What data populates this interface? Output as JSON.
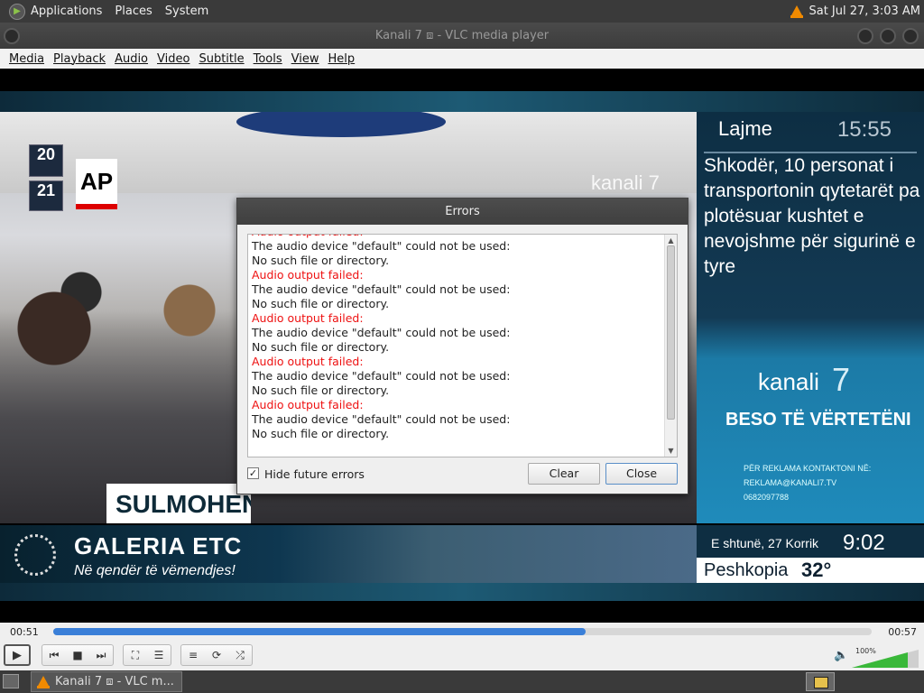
{
  "top_panel": {
    "menus": [
      "Applications",
      "Places",
      "System"
    ],
    "clock": "Sat Jul 27,  3:03 AM"
  },
  "window": {
    "title": "Kanali 7 ⧈ - VLC media player"
  },
  "menubar": [
    "Media",
    "Playback",
    "Audio",
    "Video",
    "Subtitle",
    "Tools",
    "View",
    "Help"
  ],
  "video": {
    "ap_logo": "AP",
    "gate_top": "20",
    "gate_bottom": "21",
    "watermark": "kanali 7",
    "lower_caption": "SULMOHEN",
    "side_panel": {
      "section": "Lajme",
      "time": "15:55",
      "headline": "Shkodër, 10 personat i transportonin qytetarët pa plotësuar kushtet e nevojshme për sigurinë e tyre",
      "brand": "kanali",
      "brand_num": "7",
      "slogan": "BESO TË VËRTETËNI",
      "ad_line1": "PËR REKLAMA KONTAKTONI NË:",
      "ad_email": "REKLAMA@KANALI7.TV",
      "ad_phone": "0682097788"
    },
    "ticker": {
      "title": "GALERIA ETC",
      "subtitle": "Në qendër të vëmendjes!",
      "date": "E shtunë, 27 Korrik",
      "clock": "9:02",
      "city": "Peshkopia",
      "temp": "32°"
    }
  },
  "errors_dialog": {
    "title": "Errors",
    "log": [
      {
        "type": "err",
        "text": "Audio output failed:"
      },
      {
        "type": "msg",
        "text": "The audio device \"default\" could not be used:"
      },
      {
        "type": "msg",
        "text": "No such file or directory."
      },
      {
        "type": "err",
        "text": "Audio output failed:"
      },
      {
        "type": "msg",
        "text": "The audio device \"default\" could not be used:"
      },
      {
        "type": "msg",
        "text": "No such file or directory."
      },
      {
        "type": "err",
        "text": "Audio output failed:"
      },
      {
        "type": "msg",
        "text": "The audio device \"default\" could not be used:"
      },
      {
        "type": "msg",
        "text": "No such file or directory."
      },
      {
        "type": "err",
        "text": "Audio output failed:"
      },
      {
        "type": "msg",
        "text": "The audio device \"default\" could not be used:"
      },
      {
        "type": "msg",
        "text": "No such file or directory."
      },
      {
        "type": "err",
        "text": "Audio output failed:"
      },
      {
        "type": "msg",
        "text": "The audio device \"default\" could not be used:"
      },
      {
        "type": "msg",
        "text": "No such file or directory."
      }
    ],
    "hide_future_errors_label": "Hide future errors",
    "hide_future_errors_checked": true,
    "clear_label": "Clear",
    "close_label": "Close"
  },
  "player": {
    "elapsed": "00:51",
    "total": "00:57",
    "progress_fraction": 0.65,
    "volume_label": "100%"
  },
  "taskbar": {
    "task_label": "Kanali 7 ⧈ - VLC m..."
  },
  "colors": {
    "error_text": "#e11111",
    "seek_fill": "#3a7fd8",
    "volume_fill": "#3ab83a",
    "vlc_cone": "#f08a00"
  }
}
